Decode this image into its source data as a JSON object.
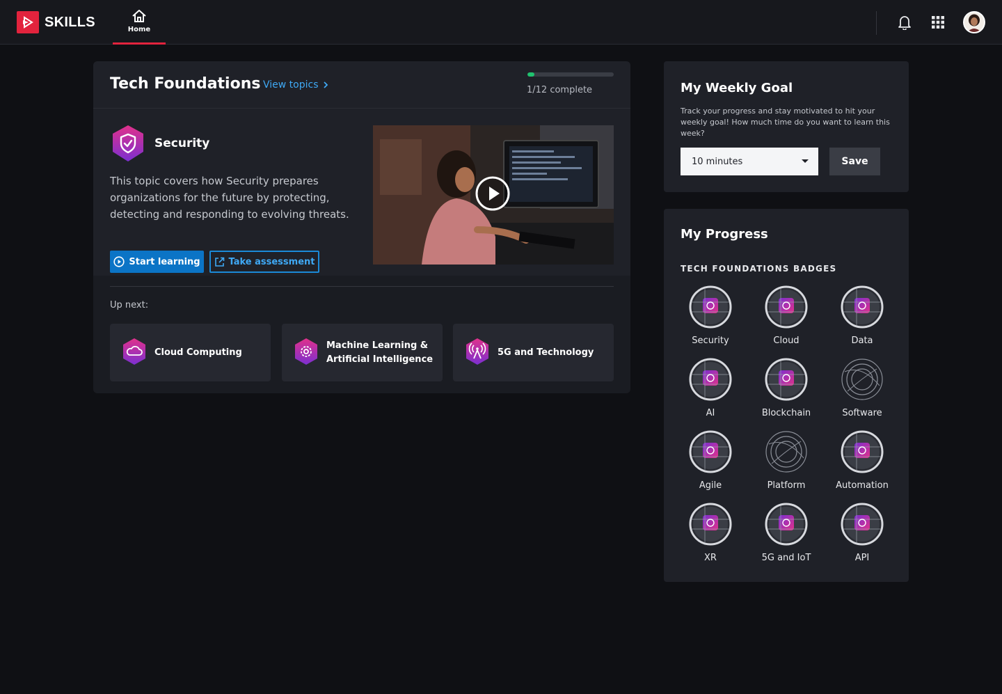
{
  "brand": {
    "name": "SKILLS",
    "accent": "#e2233d"
  },
  "nav": {
    "home_label": "Home"
  },
  "header_icons": [
    "bell-icon",
    "apps-grid-icon",
    "user-avatar"
  ],
  "foundations": {
    "title": "Tech Foundations",
    "view_topics": "View topics",
    "progress_text": "1/12 complete",
    "progress_value": 0.0833,
    "progress_color": "#20c26f"
  },
  "featured": {
    "title": "Security",
    "description": "This topic covers how Security prepares organizations for the future by protecting, detecting and responding to evolving threats.",
    "start_label": "Start learning",
    "assess_label": "Take assessment"
  },
  "up_next": {
    "label": "Up next:",
    "items": [
      {
        "title": "Cloud Computing",
        "icon": "cloud-icon"
      },
      {
        "title": "Machine Learning & Artificial Intelligence",
        "icon": "gear-icon"
      },
      {
        "title": "5G and Technology",
        "icon": "antenna-icon"
      }
    ]
  },
  "weekly_goal": {
    "title": "My Weekly Goal",
    "description": "Track your progress and stay motivated to hit your weekly goal! How much time do you want to learn this week?",
    "selected": "10 minutes",
    "save_label": "Save"
  },
  "progress": {
    "title": "My Progress",
    "subtitle": "TECH FOUNDATIONS BADGES",
    "badges": [
      {
        "label": "Security",
        "earned": true,
        "icon": "shield-icon"
      },
      {
        "label": "Cloud",
        "earned": true,
        "icon": "cloud-icon"
      },
      {
        "label": "Data",
        "earned": true,
        "icon": "data-icon"
      },
      {
        "label": "AI",
        "earned": true,
        "icon": "ai-icon"
      },
      {
        "label": "Blockchain",
        "earned": true,
        "icon": "chain-icon"
      },
      {
        "label": "Software",
        "earned": false,
        "icon": "software-icon"
      },
      {
        "label": "Agile",
        "earned": true,
        "icon": "agile-icon"
      },
      {
        "label": "Platform",
        "earned": false,
        "icon": "platform-icon"
      },
      {
        "label": "Automation",
        "earned": true,
        "icon": "automation-icon"
      },
      {
        "label": "XR",
        "earned": true,
        "icon": "xr-icon"
      },
      {
        "label": "5G and IoT",
        "earned": true,
        "icon": "antenna-icon"
      },
      {
        "label": "API",
        "earned": true,
        "icon": "api-icon"
      }
    ]
  }
}
